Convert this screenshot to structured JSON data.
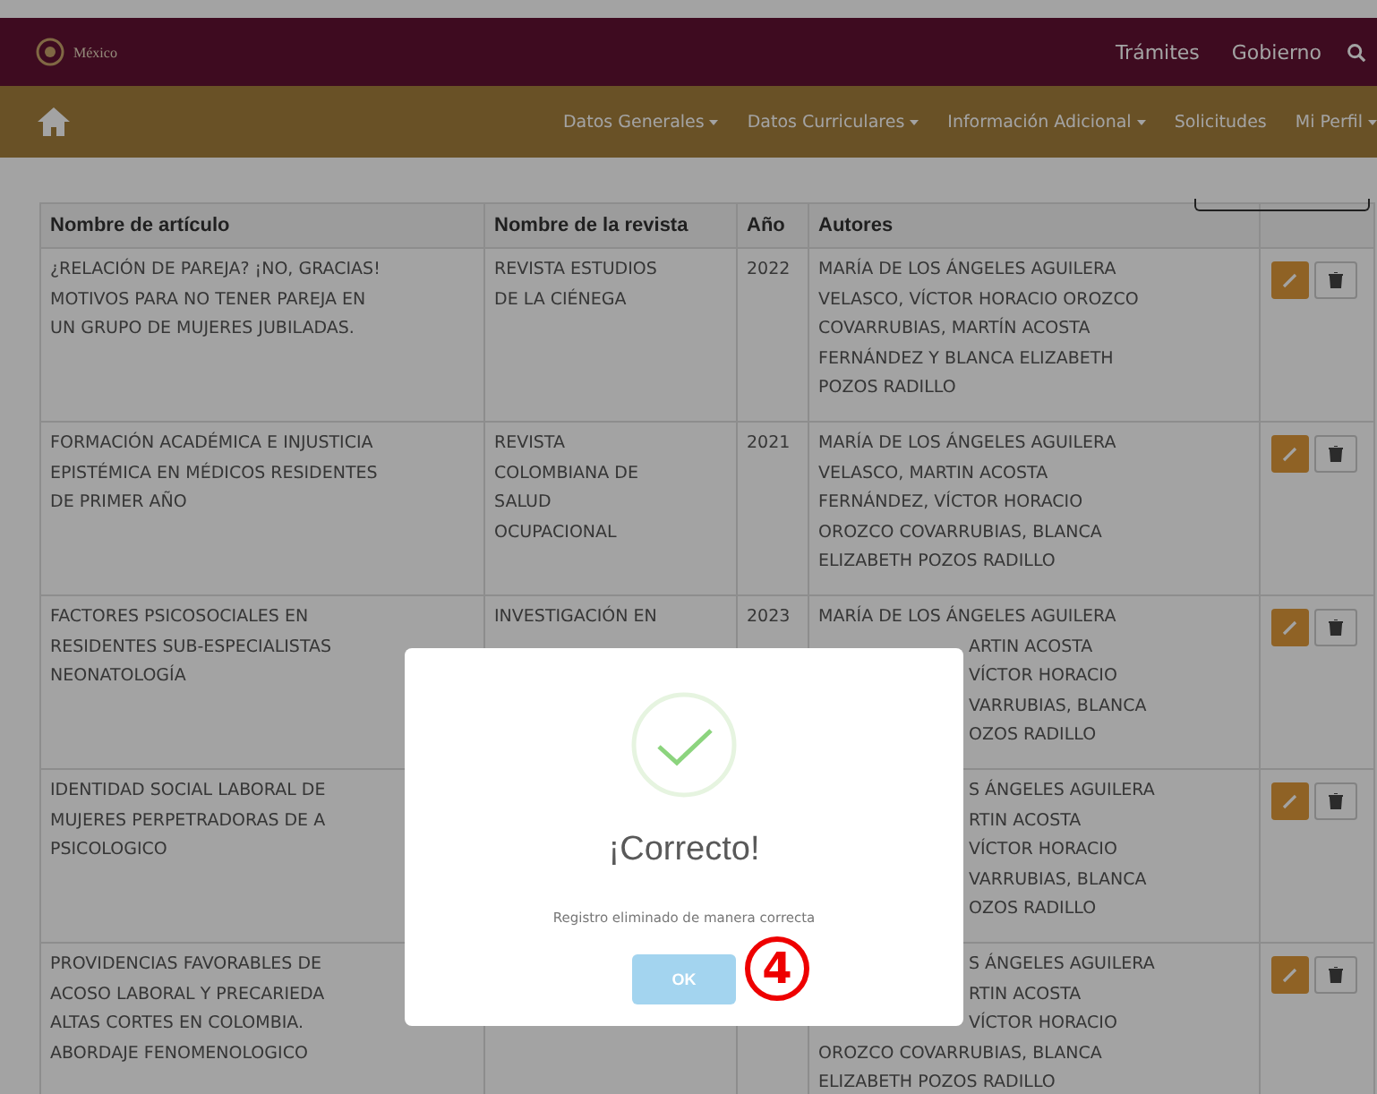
{
  "header": {
    "logo_text": "México",
    "links": [
      "Trámites",
      "Gobierno"
    ]
  },
  "nav": {
    "items": [
      {
        "label": "Datos Generales",
        "dropdown": true
      },
      {
        "label": "Datos Curriculares",
        "dropdown": true
      },
      {
        "label": "Información Adicional",
        "dropdown": true
      },
      {
        "label": "Solicitudes",
        "dropdown": false
      },
      {
        "label": "Mi Perfil",
        "dropdown": true
      }
    ]
  },
  "table": {
    "columns": [
      "Nombre de artículo",
      "Nombre de la revista",
      "Año",
      "Autores"
    ],
    "rows": [
      {
        "article": "¿RELACIÓN DE PAREJA? ¡NO, GRACIAS!\nMOTIVOS PARA NO TENER PAREJA EN\nUN GRUPO DE MUJERES JUBILADAS.",
        "journal": "REVISTA ESTUDIOS\nDE LA CIÉNEGA",
        "year": "2022",
        "authors": [
          {
            "text": "MARÍA DE LOS ÁNGELES AGUILERA",
            "kind": "full"
          },
          {
            "text": "VELASCO, VÍCTOR HORACIO OROZCO",
            "kind": "full"
          },
          {
            "text": "COVARRUBIAS, MARTÍN ACOSTA",
            "kind": "full"
          },
          {
            "text": "FERNÁNDEZ Y BLANCA ELIZABETH",
            "kind": "full"
          },
          {
            "text": "POZOS RADILLO",
            "kind": "full"
          }
        ]
      },
      {
        "article": "FORMACIÓN ACADÉMICA E INJUSTICIA\nEPISTÉMICA EN MÉDICOS RESIDENTES\nDE PRIMER AÑO",
        "journal": "REVISTA\nCOLOMBIANA DE\nSALUD\nOCUPACIONAL",
        "year": "2021",
        "authors": [
          {
            "text": "MARÍA DE LOS ÁNGELES AGUILERA",
            "kind": "full"
          },
          {
            "text": "VELASCO, MARTIN ACOSTA",
            "kind": "full"
          },
          {
            "text": "FERNÁNDEZ, VÍCTOR HORACIO",
            "kind": "full"
          },
          {
            "text": "OROZCO COVARRUBIAS, BLANCA",
            "kind": "full"
          },
          {
            "text": "ELIZABETH POZOS RADILLO",
            "kind": "full"
          }
        ]
      },
      {
        "article": "FACTORES PSICOSOCIALES EN\nRESIDENTES SUB-ESPECIALISTAS\nNEONATOLOGÍA",
        "journal": "INVESTIGACIÓN EN",
        "year": "2023",
        "authors": [
          {
            "text": "MARÍA DE LOS ÁNGELES AGUILERA",
            "kind": "full"
          },
          {
            "text": "ARTIN ACOSTA",
            "kind": "partial"
          },
          {
            "text": "VÍCTOR HORACIO",
            "kind": "partial"
          },
          {
            "text": "VARRUBIAS, BLANCA",
            "kind": "partial"
          },
          {
            "text": "OZOS RADILLO",
            "kind": "partial"
          }
        ]
      },
      {
        "article": "IDENTIDAD SOCIAL LABORAL DE\nMUJERES PERPETRADORAS DE A\nPSICOLOGICO",
        "authors": [
          {
            "text": "S ÁNGELES AGUILERA",
            "kind": "partial"
          },
          {
            "text": "RTIN ACOSTA",
            "kind": "partial"
          },
          {
            "text": "VÍCTOR HORACIO",
            "kind": "partial"
          },
          {
            "text": "VARRUBIAS, BLANCA",
            "kind": "partial"
          },
          {
            "text": "OZOS RADILLO",
            "kind": "partial"
          }
        ]
      },
      {
        "article": "PROVIDENCIAS FAVORABLES DE\nACOSO LABORAL Y PRECARIEDA\nALTAS CORTES EN COLOMBIA.\nABORDAJE FENOMENOLOGICO",
        "authors": [
          {
            "text": "S ÁNGELES AGUILERA",
            "kind": "partial"
          },
          {
            "text": "RTIN ACOSTA",
            "kind": "partial"
          },
          {
            "text": "VÍCTOR HORACIO",
            "kind": "partial"
          },
          {
            "text": "OROZCO COVARRUBIAS, BLANCA",
            "kind": "full"
          },
          {
            "text": "ELIZABETH POZOS RADILLO",
            "kind": "full"
          }
        ]
      }
    ]
  },
  "modal": {
    "title": "¡Correcto!",
    "message": "Registro eliminado de manera correcta",
    "button": "OK"
  },
  "annotation": "4"
}
